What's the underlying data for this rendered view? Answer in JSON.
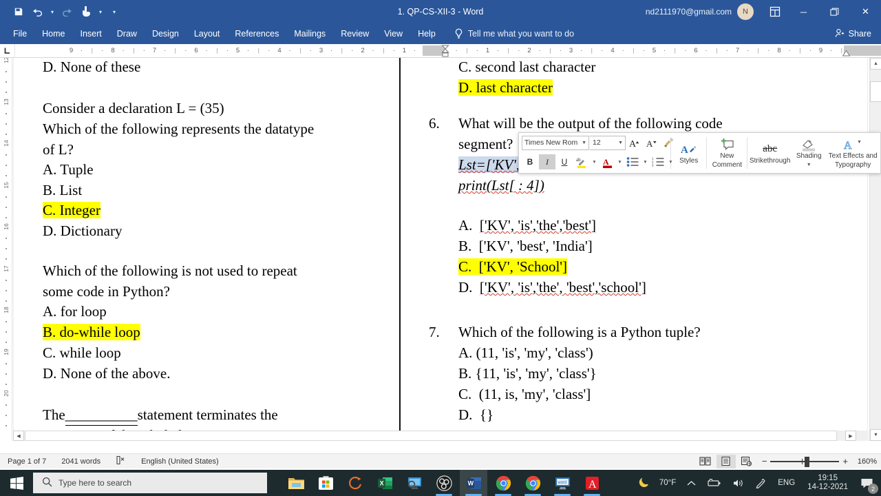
{
  "titlebar": {
    "document_title": "1. QP-CS-XII-3  -  Word",
    "account_email": "nd2111970@gmail.com",
    "avatar_initial": "N",
    "qat": [
      {
        "name": "save",
        "icon": "save-icon"
      },
      {
        "name": "undo",
        "icon": "undo-icon"
      },
      {
        "name": "redo",
        "icon": "redo-icon"
      },
      {
        "name": "touch-mode",
        "icon": "touch-mode-icon"
      },
      {
        "name": "customize-qat",
        "icon": "chevron-down-icon"
      }
    ],
    "window_controls": {
      "minimize": "─",
      "restore": "❐",
      "close": "✕"
    },
    "ribbon_display_options": "ribbon-display-icon"
  },
  "ribbon": {
    "tabs": [
      "File",
      "Home",
      "Insert",
      "Draw",
      "Design",
      "Layout",
      "References",
      "Mailings",
      "Review",
      "View",
      "Help"
    ],
    "tell_me": "Tell me what you want to do",
    "share": "Share"
  },
  "ruler": {
    "horizontal_labels_left": [
      "9",
      "8",
      "7",
      "6",
      "5",
      "4",
      "3",
      "2",
      "1"
    ],
    "horizontal_labels_right": [
      "1",
      "2",
      "3",
      "4",
      "5",
      "6",
      "7",
      "8",
      "9"
    ],
    "vertical_labels": [
      "12",
      "13",
      "14",
      "15",
      "16",
      "17",
      "18",
      "19",
      "20"
    ]
  },
  "document": {
    "left_column": [
      {
        "type": "option",
        "text": "D.  None of these"
      },
      {
        "type": "blank"
      },
      {
        "type": "line",
        "text": "Consider a declaration L = (35)"
      },
      {
        "type": "line",
        "text": "Which of the following represents the datatype"
      },
      {
        "type": "line",
        "text": "of L?"
      },
      {
        "type": "option",
        "text": "A.  Tuple"
      },
      {
        "type": "option",
        "text": "B.  List"
      },
      {
        "type": "option",
        "text": "C.  Integer",
        "highlight": true
      },
      {
        "type": "option",
        "text": "D.  Dictionary"
      },
      {
        "type": "blank"
      },
      {
        "type": "line",
        "text": "Which of the following is not used to repeat"
      },
      {
        "type": "line",
        "text": "some code in Python?"
      },
      {
        "type": "option",
        "text": "A.  for loop"
      },
      {
        "type": "option",
        "text": "B.  do-while loop",
        "highlight": true
      },
      {
        "type": "option",
        "text": "C.  while loop"
      },
      {
        "type": "option",
        "text": "D.  None of the above."
      },
      {
        "type": "blank"
      },
      {
        "type": "fillblank",
        "pre": "The",
        "blank": "__________",
        "post": "statement terminates the"
      },
      {
        "type": "line",
        "text": "execution of the whole loop"
      }
    ],
    "right_column": {
      "top_options": [
        {
          "text": "C.   second last character"
        },
        {
          "text": "D.  last character",
          "highlight": true
        }
      ],
      "question6": {
        "number": "6.",
        "line1": "What will be the output of the following code",
        "line2": "segment?",
        "code1": "Lst=['KV','School','is','the','best']",
        "code2": "print(Lst[ : 4])",
        "options": [
          {
            "label": "A.",
            "text": "['KV', 'is','the','best']"
          },
          {
            "label": "B.",
            "text": "['KV', 'best', 'India']"
          },
          {
            "label": "C.",
            "text": "['KV', 'School']",
            "highlight": true
          },
          {
            "label": "D.",
            "text": "['KV', 'is','the', 'best','school']"
          }
        ]
      },
      "question7": {
        "number": "7.",
        "line1": "Which of the following is a Python tuple?",
        "options": [
          {
            "label": "A.",
            "text": "(11, 'is', 'my', 'class')"
          },
          {
            "label": "B.",
            "text": "{11, 'is', 'my', 'class'}"
          },
          {
            "label": "C.",
            "text": "(11, is, 'my', 'class']"
          },
          {
            "label": "D.",
            "text": "{}"
          }
        ]
      }
    }
  },
  "mini_toolbar": {
    "font_name": "Times New Rom",
    "font_size": "12",
    "row1_buttons": [
      {
        "name": "grow-font",
        "label": "A˄"
      },
      {
        "name": "shrink-font",
        "label": "A˅"
      },
      {
        "name": "format-painter",
        "label": "format-painter-icon"
      }
    ],
    "styles_group": {
      "name": "styles",
      "label": "Styles"
    },
    "row2_buttons": [
      {
        "name": "bold",
        "label": "B",
        "active": false
      },
      {
        "name": "italic",
        "label": "I",
        "active": true
      },
      {
        "name": "underline",
        "label": "U",
        "active": false
      },
      {
        "name": "text-highlight-color",
        "label": "highlight-icon",
        "active": false
      },
      {
        "name": "font-color",
        "label": "font-color-icon",
        "active": false
      },
      {
        "name": "bullets",
        "label": "bullets-icon",
        "active": false
      },
      {
        "name": "numbering",
        "label": "numbering-icon",
        "active": false
      }
    ],
    "new_comment": {
      "line1": "New",
      "line2": "Comment"
    },
    "strikethrough": {
      "glyph": "abc",
      "label": "Strikethrough"
    },
    "shading": {
      "label": "Shading"
    },
    "text_effects": {
      "line1": "Text Effects and",
      "line2": "Typography"
    }
  },
  "statusbar": {
    "page": "Page 1 of 7",
    "words": "2041 words",
    "proofing_icon": "proofing-icon",
    "language": "English (United States)",
    "views": [
      {
        "name": "read-mode",
        "active": false
      },
      {
        "name": "print-layout",
        "active": true
      },
      {
        "name": "web-layout",
        "active": false
      }
    ],
    "zoom_out": "−",
    "zoom_in": "+",
    "zoom_level": "160%"
  },
  "taskbar": {
    "start": "windows-logo-icon",
    "search_placeholder": "Type here to search",
    "apps": [
      {
        "name": "file-explorer",
        "icon": "folder-icon",
        "active": false,
        "running": false
      },
      {
        "name": "microsoft-store",
        "icon": "store-icon",
        "active": false,
        "running": false
      },
      {
        "name": "firefox-or-app",
        "icon": "ring-icon",
        "active": false,
        "running": false
      },
      {
        "name": "excel",
        "icon": "excel-icon",
        "active": false,
        "running": false
      },
      {
        "name": "remote-desktop",
        "icon": "monitor-search-icon",
        "active": false,
        "running": false
      },
      {
        "name": "obs-studio",
        "icon": "obs-icon",
        "active": false,
        "running": true
      },
      {
        "name": "word",
        "icon": "word-icon",
        "active": true,
        "running": true
      },
      {
        "name": "chrome-profile-1",
        "icon": "chrome-icon",
        "active": false,
        "running": true
      },
      {
        "name": "chrome-profile-2",
        "icon": "chrome-icon",
        "active": false,
        "running": true
      },
      {
        "name": "presentation-app",
        "icon": "screen-icon",
        "active": false,
        "running": true
      },
      {
        "name": "adobe-acrobat",
        "icon": "acrobat-icon",
        "active": false,
        "running": true
      }
    ],
    "weather": {
      "icon": "moon-icon",
      "temp": "70°F"
    },
    "tray": [
      {
        "name": "show-hidden-icons",
        "icon": "chevron-up-icon"
      },
      {
        "name": "battery",
        "icon": "battery-icon"
      },
      {
        "name": "volume",
        "icon": "speaker-icon"
      },
      {
        "name": "bluetooth-or-pen",
        "icon": "pen-icon"
      }
    ],
    "language_indicator": "ENG",
    "clock_time": "19:15",
    "clock_date": "14-12-2021",
    "notifications_count": "2"
  }
}
